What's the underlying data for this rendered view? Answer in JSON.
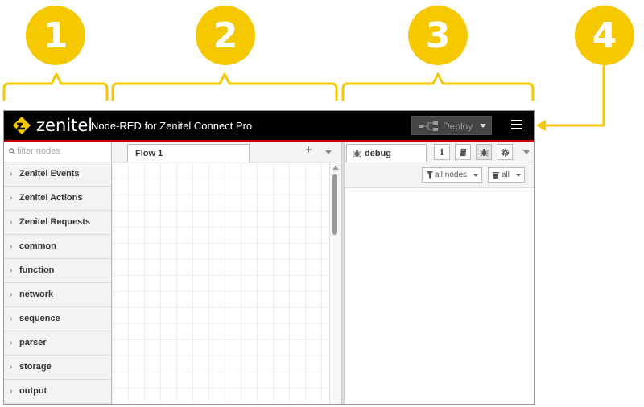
{
  "callouts": [
    "1",
    "2",
    "3",
    "4"
  ],
  "header": {
    "brand": "zenitel",
    "app_title": "Node-RED for Zenitel Connect Pro",
    "deploy_label": "Deploy",
    "icons": [
      "zenitel-logo-icon",
      "deploy-flow-icon",
      "chevron-down-icon",
      "hamburger-menu-icon"
    ]
  },
  "palette": {
    "filter_placeholder": "filter nodes",
    "categories": [
      "Zenitel Events",
      "Zenitel Actions",
      "Zenitel Requests",
      "common",
      "function",
      "network",
      "sequence",
      "parser",
      "storage",
      "output"
    ]
  },
  "workspace": {
    "tabs": [
      {
        "label": "Flow 1"
      }
    ],
    "add_label": "+"
  },
  "sidebar": {
    "active_tab": "debug",
    "buttons": [
      "info-icon",
      "book-icon",
      "bug-icon",
      "gear-icon"
    ],
    "filter_label": "all nodes",
    "clear_label": "all"
  },
  "colors": {
    "callout": "#f5c800",
    "header_bg": "#000000",
    "header_accent": "#cc0000",
    "palette_bg": "#f3f3f3"
  }
}
